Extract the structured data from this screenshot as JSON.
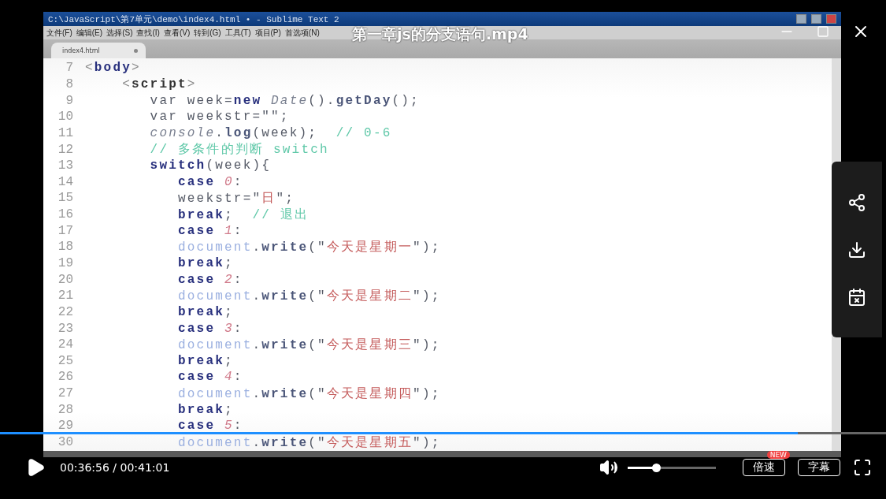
{
  "player": {
    "title": "第一章js的分支语句.mp4"
  },
  "editor": {
    "title": "C:\\JavaScript\\第7单元\\demo\\index4.html • - Sublime Text 2",
    "menu": [
      "文件(F)",
      "编辑(E)",
      "选择(S)",
      "查找(I)",
      "查看(V)",
      "转到(G)",
      "工具(T)",
      "项目(P)",
      "首选项(N)"
    ],
    "tabs": [
      {
        "label": "index4.html",
        "selected": true
      }
    ],
    "lines": [
      {
        "number": "7",
        "tokens": [
          {
            "text": "<",
            "kind": "punct"
          },
          {
            "text": "body",
            "kind": "kw"
          },
          {
            "text": ">",
            "kind": "punct"
          }
        ]
      },
      {
        "number": "8",
        "tokens": [
          {
            "text": "    <",
            "kind": "punct"
          },
          {
            "text": "script",
            "kind": "tag"
          },
          {
            "text": ">",
            "kind": "punct"
          }
        ]
      },
      {
        "number": "9",
        "tokens": [
          {
            "text": "       var week=",
            "kind": "plain"
          },
          {
            "text": "new ",
            "kind": "kw"
          },
          {
            "text": "Date",
            "kind": "italic"
          },
          {
            "text": "().",
            "kind": "plain"
          },
          {
            "text": "getDay",
            "kind": "method"
          },
          {
            "text": "();",
            "kind": "plain"
          }
        ]
      },
      {
        "number": "10",
        "tokens": [
          {
            "text": "       var weekstr=\"\";",
            "kind": "plain"
          }
        ]
      },
      {
        "number": "11",
        "tokens": [
          {
            "text": "       console",
            "kind": "italic"
          },
          {
            "text": ".",
            "kind": "plain"
          },
          {
            "text": "log",
            "kind": "method"
          },
          {
            "text": "(week);  ",
            "kind": "plain"
          },
          {
            "text": "// 0-6",
            "kind": "comment"
          }
        ]
      },
      {
        "number": "12",
        "tokens": [
          {
            "text": "       // 多条件的判断 switch",
            "kind": "comment"
          }
        ]
      },
      {
        "number": "13",
        "tokens": [
          {
            "text": "       switch",
            "kind": "kw"
          },
          {
            "text": "(week){",
            "kind": "plain"
          }
        ]
      },
      {
        "number": "14",
        "tokens": [
          {
            "text": "          case ",
            "kind": "kw"
          },
          {
            "text": "0",
            "kind": "num"
          },
          {
            "text": ":",
            "kind": "plain"
          }
        ]
      },
      {
        "number": "15",
        "tokens": [
          {
            "text": "          weekstr=\"",
            "kind": "plain"
          },
          {
            "text": "日",
            "kind": "str"
          },
          {
            "text": "\";",
            "kind": "plain"
          }
        ]
      },
      {
        "number": "16",
        "tokens": [
          {
            "text": "          break",
            "kind": "kw"
          },
          {
            "text": ";  ",
            "kind": "plain"
          },
          {
            "text": "// 退出",
            "kind": "comment"
          }
        ]
      },
      {
        "number": "17",
        "tokens": [
          {
            "text": "          case ",
            "kind": "kw"
          },
          {
            "text": "1",
            "kind": "num"
          },
          {
            "text": ":",
            "kind": "plain"
          }
        ]
      },
      {
        "number": "18",
        "tokens": [
          {
            "text": "          document",
            "kind": "obj"
          },
          {
            "text": ".",
            "kind": "plain"
          },
          {
            "text": "write",
            "kind": "method"
          },
          {
            "text": "(\"",
            "kind": "plain"
          },
          {
            "text": "今天是星期一",
            "kind": "str"
          },
          {
            "text": "\");",
            "kind": "plain"
          }
        ]
      },
      {
        "number": "19",
        "tokens": [
          {
            "text": "          break",
            "kind": "kw"
          },
          {
            "text": ";",
            "kind": "plain"
          }
        ]
      },
      {
        "number": "20",
        "tokens": [
          {
            "text": "          case ",
            "kind": "kw"
          },
          {
            "text": "2",
            "kind": "num"
          },
          {
            "text": ":",
            "kind": "plain"
          }
        ]
      },
      {
        "number": "21",
        "tokens": [
          {
            "text": "          document",
            "kind": "obj"
          },
          {
            "text": ".",
            "kind": "plain"
          },
          {
            "text": "write",
            "kind": "method"
          },
          {
            "text": "(\"",
            "kind": "plain"
          },
          {
            "text": "今天是星期二",
            "kind": "str"
          },
          {
            "text": "\");",
            "kind": "plain"
          }
        ]
      },
      {
        "number": "22",
        "tokens": [
          {
            "text": "          break",
            "kind": "kw"
          },
          {
            "text": ";",
            "kind": "plain"
          }
        ]
      },
      {
        "number": "23",
        "tokens": [
          {
            "text": "          case ",
            "kind": "kw"
          },
          {
            "text": "3",
            "kind": "num"
          },
          {
            "text": ":",
            "kind": "plain"
          }
        ]
      },
      {
        "number": "24",
        "tokens": [
          {
            "text": "          document",
            "kind": "obj"
          },
          {
            "text": ".",
            "kind": "plain"
          },
          {
            "text": "write",
            "kind": "method"
          },
          {
            "text": "(\"",
            "kind": "plain"
          },
          {
            "text": "今天是星期三",
            "kind": "str"
          },
          {
            "text": "\");",
            "kind": "plain"
          }
        ]
      },
      {
        "number": "25",
        "tokens": [
          {
            "text": "          break",
            "kind": "kw"
          },
          {
            "text": ";",
            "kind": "plain"
          }
        ]
      },
      {
        "number": "26",
        "tokens": [
          {
            "text": "          case ",
            "kind": "kw"
          },
          {
            "text": "4",
            "kind": "num"
          },
          {
            "text": ":",
            "kind": "plain"
          }
        ]
      },
      {
        "number": "27",
        "tokens": [
          {
            "text": "          document",
            "kind": "obj"
          },
          {
            "text": ".",
            "kind": "plain"
          },
          {
            "text": "write",
            "kind": "method"
          },
          {
            "text": "(\"",
            "kind": "plain"
          },
          {
            "text": "今天是星期四",
            "kind": "str"
          },
          {
            "text": "\");",
            "kind": "plain"
          }
        ]
      },
      {
        "number": "28",
        "tokens": [
          {
            "text": "          break",
            "kind": "kw"
          },
          {
            "text": ";",
            "kind": "plain"
          }
        ]
      },
      {
        "number": "29",
        "tokens": [
          {
            "text": "          case ",
            "kind": "kw"
          },
          {
            "text": "5",
            "kind": "num"
          },
          {
            "text": ":",
            "kind": "plain"
          }
        ]
      },
      {
        "number": "30",
        "tokens": [
          {
            "text": "          document",
            "kind": "obj"
          },
          {
            "text": ".",
            "kind": "plain"
          },
          {
            "text": "write",
            "kind": "method"
          },
          {
            "text": "(\"",
            "kind": "plain"
          },
          {
            "text": "今天是星期五",
            "kind": "str"
          },
          {
            "text": "\");",
            "kind": "plain"
          }
        ]
      }
    ]
  },
  "controls": {
    "progress": {
      "level": 0.9
    },
    "time": "00:36:56 / 00:41:01",
    "volume": {
      "level": 0.32
    },
    "speed_button": "倍速",
    "speed_badge": "NEW",
    "subtitles_button": "字幕"
  }
}
